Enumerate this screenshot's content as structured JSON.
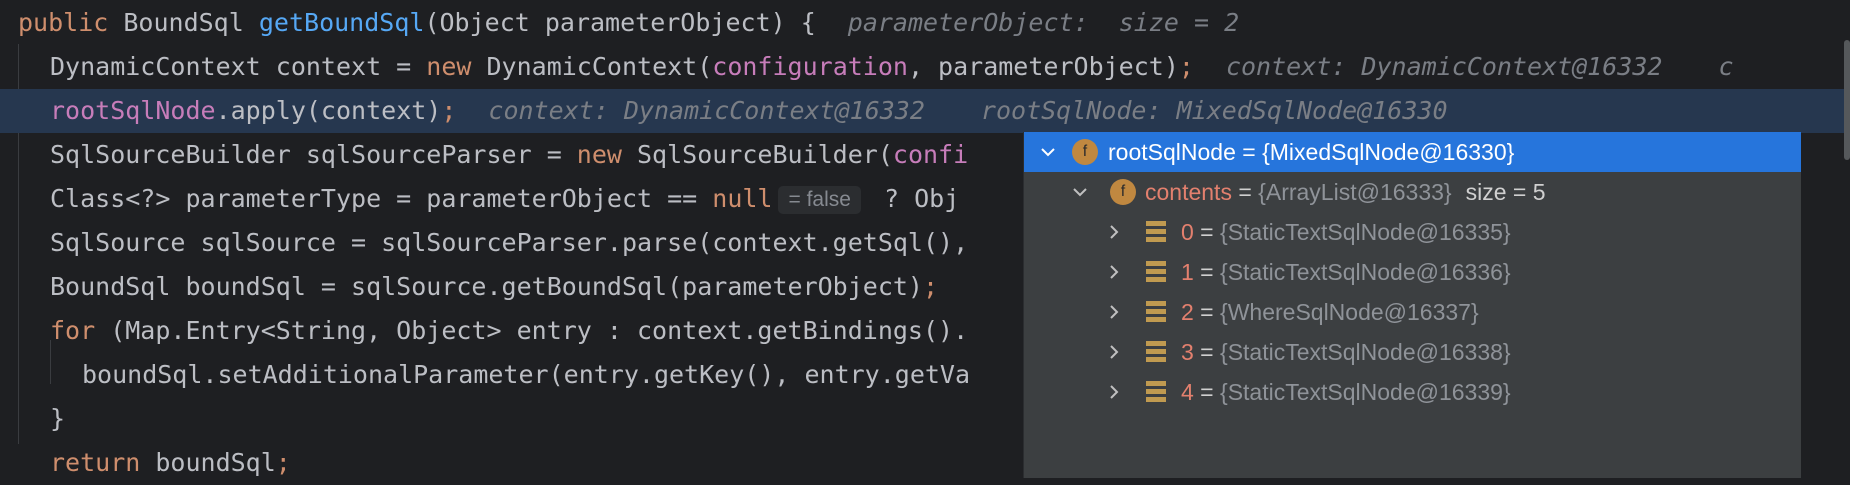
{
  "code": {
    "line1": {
      "k_public": "public",
      "t_type": "BoundSql",
      "method": "getBoundSql",
      "params": "(Object parameterObject) {",
      "hint": "parameterObject:  size = 2"
    },
    "line2": {
      "t1": "DynamicContext context = ",
      "k_new": "new",
      "t2": " DynamicContext(",
      "f_config": "configuration",
      "t3": ", parameterObject)",
      "semi": ";",
      "hint": "context: DynamicContext@16332",
      "hint_overflow": "c"
    },
    "line3": {
      "f_root": "rootSqlNode",
      "t1": ".apply(context)",
      "semi": ";",
      "hint1": "context: DynamicContext@16332",
      "hint2": "rootSqlNode: MixedSqlNode@16330"
    },
    "line4": {
      "t1": "SqlSourceBuilder sqlSourceParser = ",
      "k_new": "new",
      "t2": " SqlSourceBuilder(",
      "f_trunc": "confi"
    },
    "line5": {
      "t1": "Class<?> parameterType = parameterObject == ",
      "k_null": "null",
      "inlay": "= false",
      "t2": " ? Obj"
    },
    "line6": {
      "t1": "SqlSource sqlSource = sqlSourceParser.parse(context.getSql(),"
    },
    "line7": {
      "t1": "BoundSql boundSql = sqlSource.getBoundSql(parameterObject)",
      "semi": ";"
    },
    "line8": {
      "k_for": "for",
      "t1": " (Map.Entry<String, Object> entry : context.getBindings()."
    },
    "line9": {
      "t1": "boundSql.setAdditionalParameter(entry.getKey(), entry.getVa"
    },
    "line10": {
      "t1": "}"
    },
    "line11": {
      "k_return": "return",
      "t1": " boundSql",
      "semi": ";"
    }
  },
  "popup": {
    "root": {
      "badge": "f",
      "name": "rootSqlNode",
      "eq": " = ",
      "value": "{MixedSqlNode@16330}"
    },
    "contents": {
      "badge": "f",
      "name": "contents",
      "eq": " = ",
      "value": "{ArrayList@16333}",
      "size": "size = 5"
    },
    "items": [
      {
        "index": "0",
        "eq": " = ",
        "value": "{StaticTextSqlNode@16335}"
      },
      {
        "index": "1",
        "eq": " = ",
        "value": "{StaticTextSqlNode@16336}"
      },
      {
        "index": "2",
        "eq": " = ",
        "value": "{WhereSqlNode@16337}"
      },
      {
        "index": "3",
        "eq": " = ",
        "value": "{StaticTextSqlNode@16338}"
      },
      {
        "index": "4",
        "eq": " = ",
        "value": "{StaticTextSqlNode@16339}"
      }
    ]
  },
  "colors": {
    "editor_bg": "#1e1f22",
    "current_line": "#26374f",
    "popup_bg": "#3c3f41",
    "selection": "#2675dc",
    "keyword": "#cf8e6d",
    "method": "#56a8f5",
    "field": "#c77dba"
  }
}
